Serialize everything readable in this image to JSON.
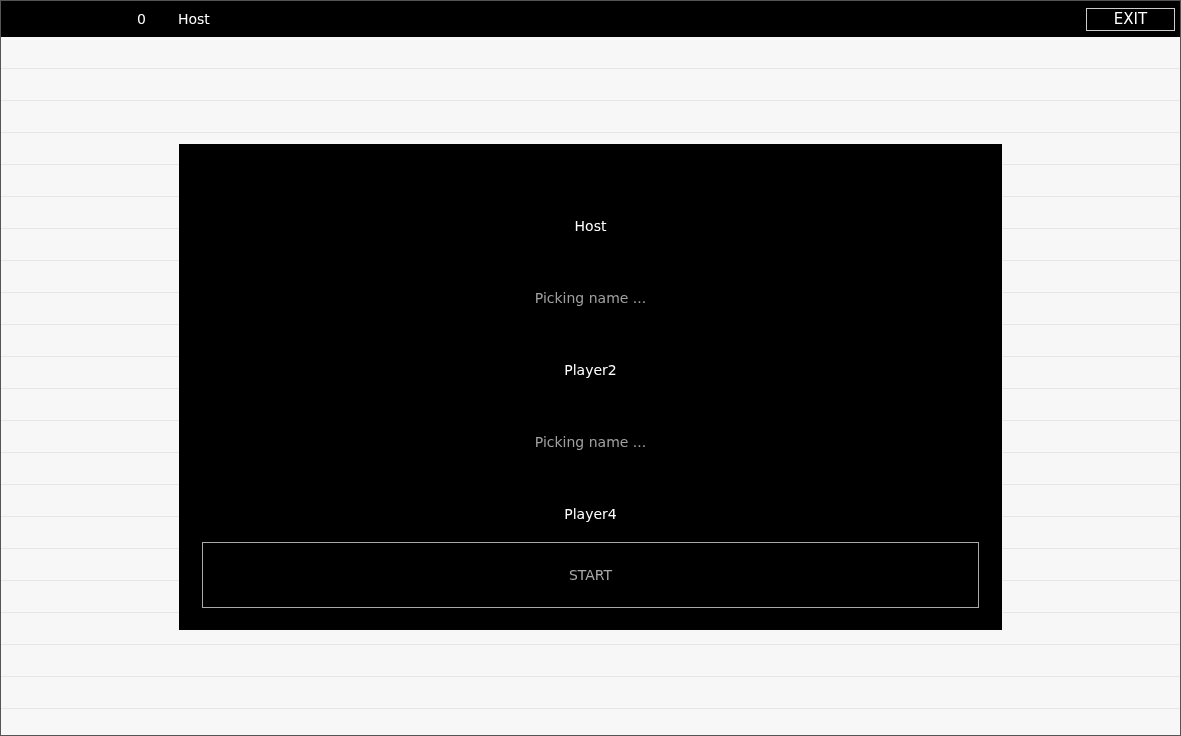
{
  "top_bar": {
    "score": "0",
    "player_name": "Host",
    "exit_button": "EXIT"
  },
  "players": [
    {
      "name": "Host",
      "ready": true
    },
    {
      "name": "Picking name ...",
      "ready": false
    },
    {
      "name": "Player2",
      "ready": true
    },
    {
      "name": "Picking name ...",
      "ready": false
    },
    {
      "name": "Player4",
      "ready": true
    }
  ],
  "start_button": {
    "label": "START",
    "disabled": true
  }
}
